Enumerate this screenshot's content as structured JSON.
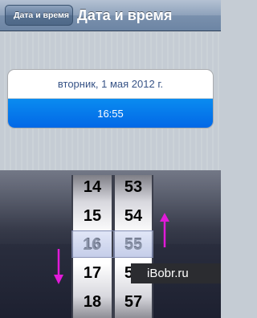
{
  "navbar": {
    "back_label": "Дата и время",
    "title": "Дата и время"
  },
  "settings": {
    "date_text": "вторник, 1 мая 2012 г.",
    "time_text": "16:55"
  },
  "picker": {
    "hours": [
      "14",
      "15",
      "16",
      "17",
      "18"
    ],
    "minutes": [
      "53",
      "54",
      "55",
      "56",
      "57"
    ],
    "selected_hour": "16",
    "selected_minute": "55"
  },
  "watermark": "iBobr.ru",
  "colors": {
    "accent_blue": "#0273e8",
    "arrow_magenta": "#e11ad8"
  }
}
